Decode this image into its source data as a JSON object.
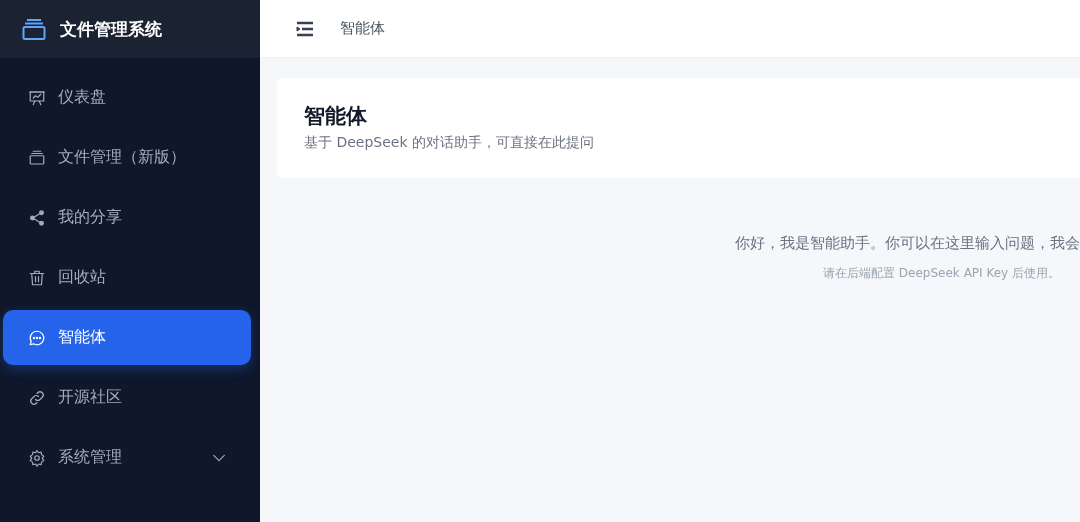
{
  "sidebar": {
    "title": "文件管理系统",
    "items": [
      {
        "label": "仪表盘",
        "selected": false
      },
      {
        "label": "文件管理（新版）",
        "selected": false
      },
      {
        "label": "我的分享",
        "selected": false
      },
      {
        "label": "回收站",
        "selected": false
      },
      {
        "label": "智能体",
        "selected": true
      },
      {
        "label": "开源社区",
        "selected": false
      },
      {
        "label": "系统管理",
        "selected": false,
        "expanded": false
      }
    ]
  },
  "header": {
    "breadcrumb": "智能体"
  },
  "page": {
    "title": "智能体",
    "subtitle": "基于 DeepSeek 的对话助手，可直接在此提问"
  },
  "chat": {
    "greeting": "你好，我是智能助手。你可以在这里输入问题，我会",
    "hint": "请在后端配置 DeepSeek API Key 后使用。"
  }
}
